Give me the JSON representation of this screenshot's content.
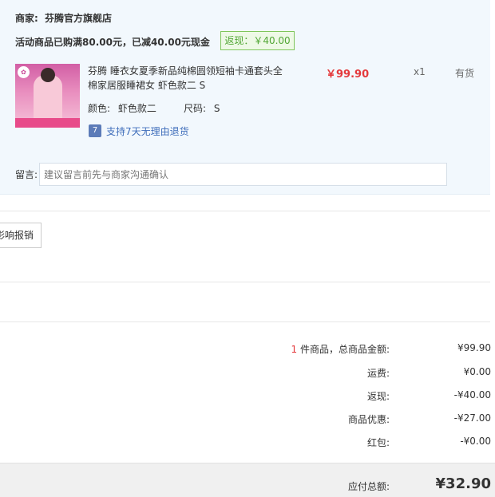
{
  "shop": {
    "seller_label": "商家:",
    "seller_name": "芬腾官方旗舰店",
    "promo_text": "活动商品已购满80.00元，已减40.00元现金",
    "rebate_badge": "返现：￥40.00"
  },
  "item": {
    "title": "芬腾 睡衣女夏季新品纯棉圆领短袖卡通套头全棉家居服睡裙女 虾色款二 S",
    "price": "￥99.90",
    "quantity": "x1",
    "stock": "有货",
    "color_label": "颜色:",
    "color_value": "虾色款二",
    "size_label": "尺码:",
    "size_value": "S",
    "return_badge": "7",
    "return_policy": "支持7天无理由退货"
  },
  "message": {
    "label": "留言:",
    "placeholder": "建议留言前先与商家沟通确认"
  },
  "invoice_button": "影响报销",
  "summary": {
    "count": "1",
    "count_suffix": "件商品，总商品金额:",
    "goods_total": "¥99.90",
    "shipping_label": "运费:",
    "shipping_value": "¥0.00",
    "cashback_label": "返现:",
    "cashback_value": "-¥40.00",
    "discount_label": "商品优惠:",
    "discount_value": "-¥27.00",
    "redpacket_label": "红包:",
    "redpacket_value": "-¥0.00",
    "payable_label": "应付总额:",
    "payable_value": "¥32.90"
  }
}
